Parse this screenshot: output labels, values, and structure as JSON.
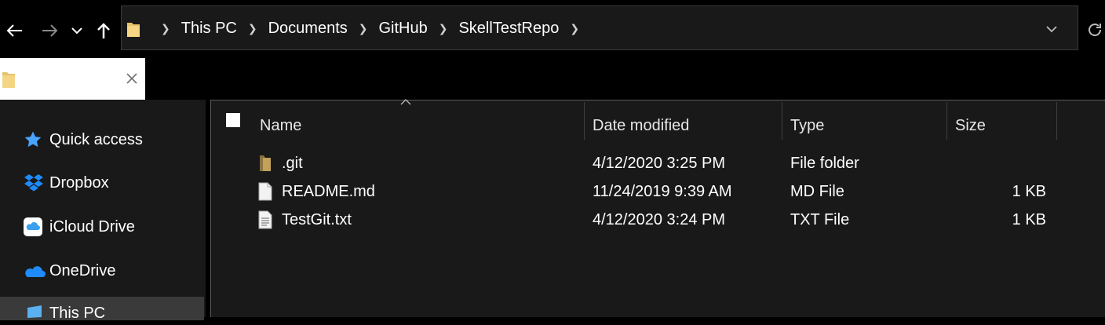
{
  "breadcrumbs": [
    "This PC",
    "Documents",
    "GitHub",
    "SkellTestRepo"
  ],
  "sidebar": {
    "items": [
      {
        "label": "Quick access",
        "icon": "star-icon"
      },
      {
        "label": "Dropbox",
        "icon": "dropbox-icon"
      },
      {
        "label": "iCloud Drive",
        "icon": "icloud-icon"
      },
      {
        "label": "OneDrive",
        "icon": "onedrive-icon"
      },
      {
        "label": "This PC",
        "icon": "computer-icon"
      }
    ]
  },
  "columns": {
    "name": "Name",
    "date": "Date modified",
    "type": "Type",
    "size": "Size"
  },
  "files": [
    {
      "name": ".git",
      "date": "4/12/2020 3:25 PM",
      "type": "File folder",
      "size": "",
      "icon": "folder-icon"
    },
    {
      "name": "README.md",
      "date": "11/24/2019 9:39 AM",
      "type": "MD File",
      "size": "1 KB",
      "icon": "file-icon"
    },
    {
      "name": "TestGit.txt",
      "date": "4/12/2020 3:24 PM",
      "type": "TXT File",
      "size": "1 KB",
      "icon": "text-file-icon"
    }
  ],
  "colors": {
    "background": "#000000",
    "pane": "#191919",
    "accent_star": "#4aa3ff",
    "folder": "#e6c36a"
  }
}
